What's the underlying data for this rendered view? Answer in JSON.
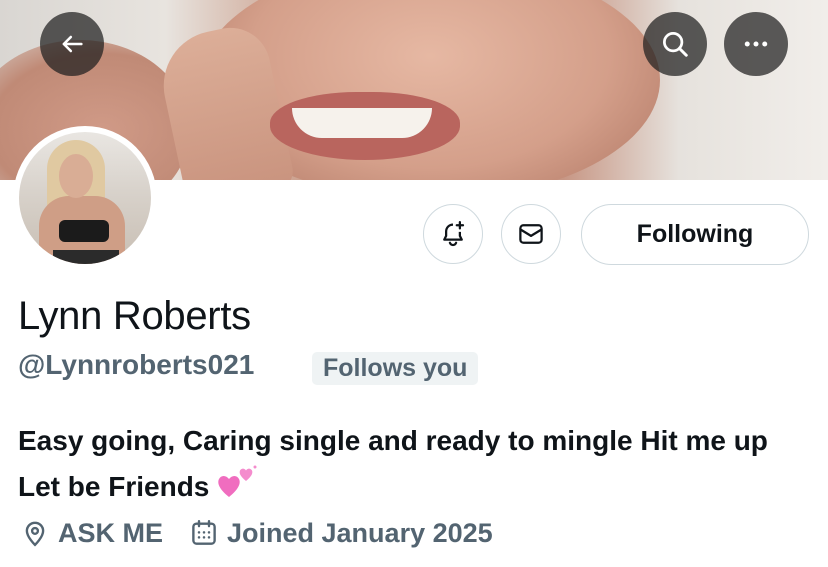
{
  "profile": {
    "display_name": "Lynn Roberts",
    "handle": "@Lynnroberts021",
    "follows_you_badge": "Follows you",
    "bio": "Easy going, Caring single and ready to mingle Hit me up Let be Friends",
    "bio_emoji": "two-hearts-emoji",
    "location": "ASK ME",
    "joined": "Joined January 2025"
  },
  "header": {
    "back_icon": "back-arrow-icon",
    "search_icon": "search-icon",
    "more_icon": "more-horizontal-icon"
  },
  "actions": {
    "notify_icon": "bell-plus-icon",
    "message_icon": "envelope-icon",
    "following_label": "Following"
  },
  "colors": {
    "text_primary": "#0f1419",
    "text_secondary": "#536471",
    "badge_bg": "#eff3f4",
    "border": "#cfd9de",
    "heart": "#f06dbf"
  }
}
